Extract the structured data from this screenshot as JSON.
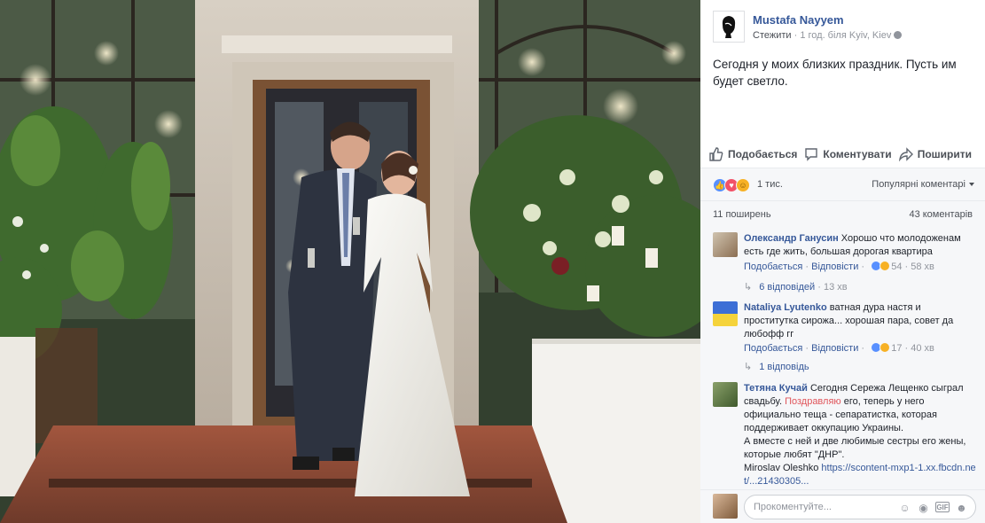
{
  "post": {
    "page_name": "Mustafa Nayyem",
    "follow_label": "Стежити",
    "meta_separator": " · ",
    "time_location": "1 год. біля Kyiv, Kiev",
    "text": "Сегодня у моих близких праздник. Пусть им будет светло."
  },
  "actions": {
    "like_label": "Подобається",
    "comment_label": "Коментувати",
    "share_label": "Поширити"
  },
  "reactions": {
    "count": "1 тис.",
    "sort_label": "Популярні коментарі",
    "shares": "11 поширень",
    "comments_count": "43 коментарів"
  },
  "comments": [
    {
      "author": "Олександр Ганусин",
      "text": "Хорошо что молодоженам есть где жить, большая дорогая квартира",
      "like_label": "Подобається",
      "reply_label": "Відповісти",
      "reaction_count": "54",
      "time": "58 хв",
      "replies_label": "6 відповідей",
      "replies_time": "13 хв",
      "icons": [
        "like-icon",
        "haha-icon"
      ]
    },
    {
      "author": "Nataliya Lyutenko",
      "text": "ватная дура настя и проститутка сирожа... хорошая пара, совет да любофф гг",
      "like_label": "Подобається",
      "reply_label": "Відповісти",
      "reaction_count": "17",
      "time": "40 хв",
      "replies_label": "1 відповідь",
      "icons": [
        "like-icon",
        "haha-icon"
      ]
    },
    {
      "author": "Тетяна Кучай",
      "text_before": "Сегодня Сережа Лещенко сыграл свадьбу.",
      "highlight": "Поздравляю",
      "text_after": "его, теперь у него официально теща - сепаратистка, которая поддерживает оккупацию Украины.",
      "text_line2": "А вместе с ней и две любимые сестры его жены, которые любят \"ДНР\".",
      "mention": "Miroslav Oleshko",
      "link": "https://scontent-mxp1-1.xx.fbcdn.net/...21430305..."
    }
  ],
  "composer": {
    "placeholder": "Прокоментуйте...",
    "icons": [
      "emoji-icon",
      "camera-icon",
      "gif-icon",
      "sticker-icon"
    ]
  },
  "colors": {
    "link": "#365899",
    "muted": "#90949c",
    "panel_bg": "#f6f7f9",
    "like": "#5890ff",
    "love": "#f25268",
    "haha": "#f7b125"
  }
}
